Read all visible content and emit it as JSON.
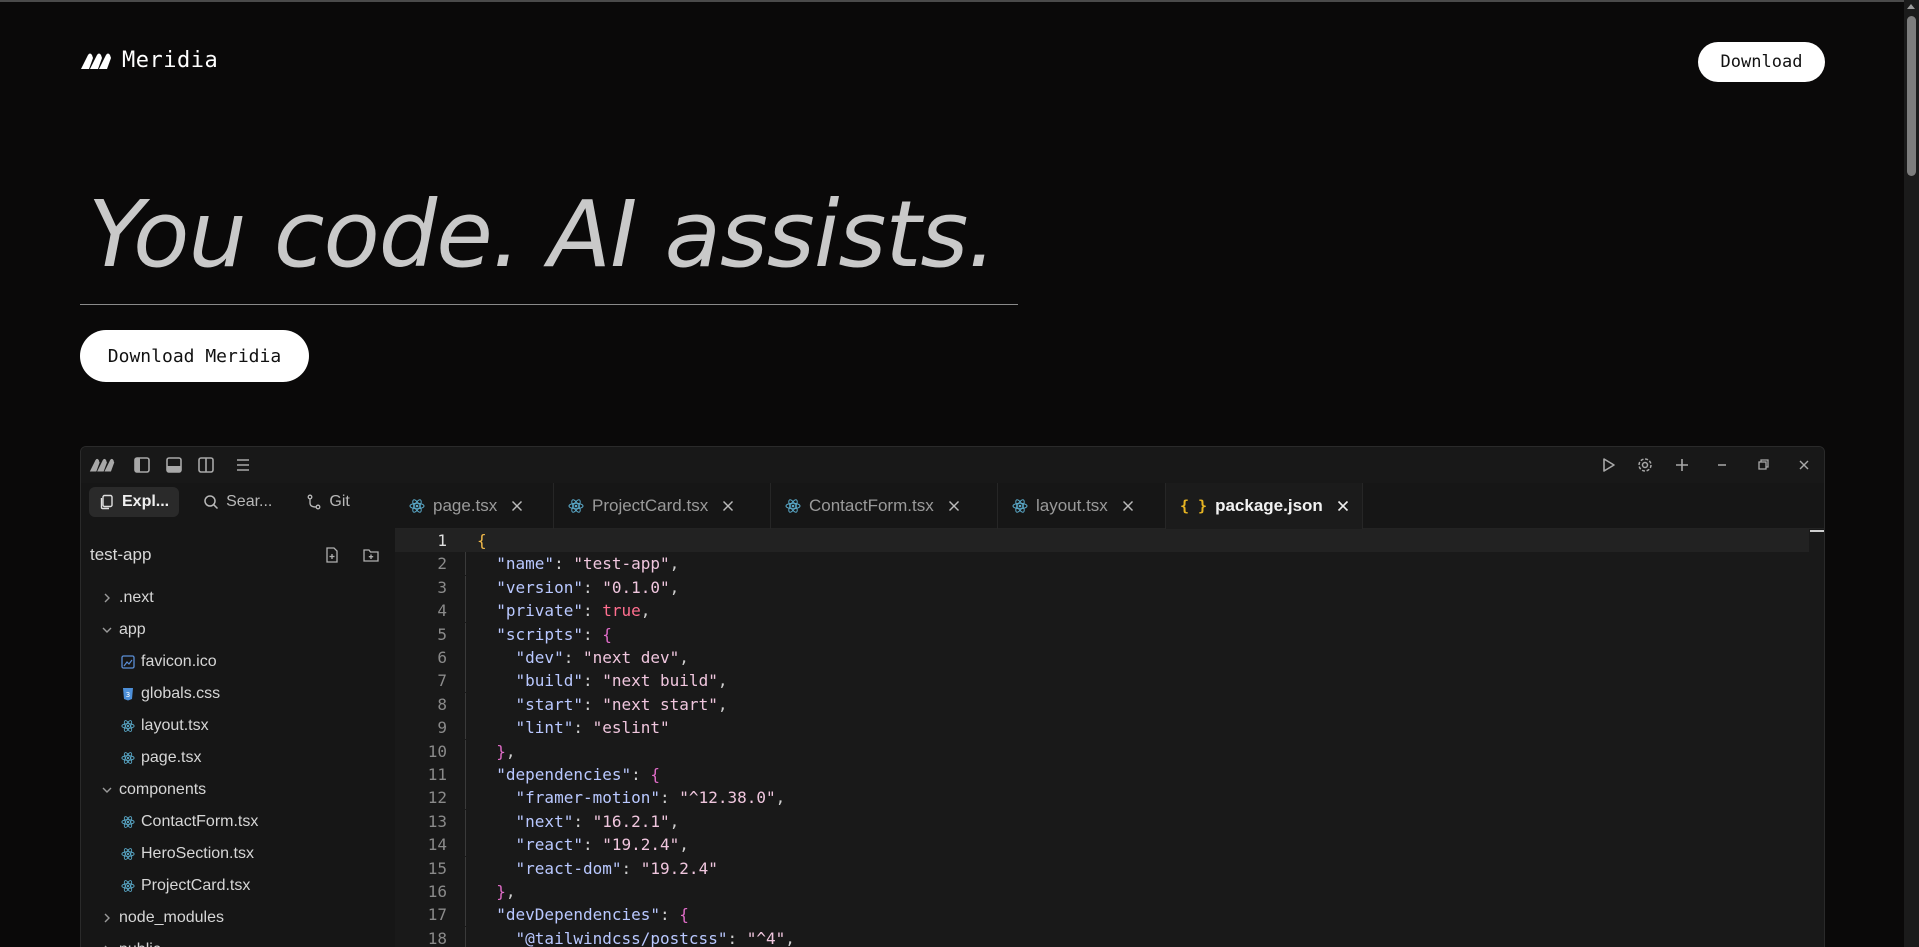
{
  "header": {
    "brand_name": "Meridia",
    "download_label": "Download"
  },
  "hero": {
    "title": "You code. AI assists.",
    "download_label": "Download Meridia"
  },
  "editor": {
    "sidebar": {
      "tabs": [
        {
          "label": "Expl...",
          "icon": "files-icon",
          "active": true
        },
        {
          "label": "Sear...",
          "icon": "search-icon",
          "active": false
        },
        {
          "label": "Git",
          "icon": "git-branch-icon",
          "active": false
        }
      ],
      "project_name": "test-app",
      "tree": [
        {
          "label": ".next",
          "type": "folder",
          "expanded": false,
          "depth": 0
        },
        {
          "label": "app",
          "type": "folder",
          "expanded": true,
          "depth": 0
        },
        {
          "label": "favicon.ico",
          "type": "image",
          "depth": 1
        },
        {
          "label": "globals.css",
          "type": "css",
          "depth": 1
        },
        {
          "label": "layout.tsx",
          "type": "react",
          "depth": 1
        },
        {
          "label": "page.tsx",
          "type": "react",
          "depth": 1
        },
        {
          "label": "components",
          "type": "folder",
          "expanded": true,
          "depth": 0
        },
        {
          "label": "ContactForm.tsx",
          "type": "react",
          "depth": 1
        },
        {
          "label": "HeroSection.tsx",
          "type": "react",
          "depth": 1
        },
        {
          "label": "ProjectCard.tsx",
          "type": "react",
          "depth": 1
        },
        {
          "label": "node_modules",
          "type": "folder",
          "expanded": false,
          "depth": 0
        },
        {
          "label": "public",
          "type": "folder",
          "expanded": false,
          "depth": 0
        }
      ]
    },
    "tabs": [
      {
        "label": "page.tsx",
        "icon": "react-icon",
        "active": false
      },
      {
        "label": "ProjectCard.tsx",
        "icon": "react-icon",
        "active": false
      },
      {
        "label": "ContactForm.tsx",
        "icon": "react-icon",
        "active": false
      },
      {
        "label": "layout.tsx",
        "icon": "react-icon",
        "active": false
      },
      {
        "label": "package.json",
        "icon": "json-icon",
        "active": true
      }
    ],
    "json_icon_glyph": "{ }",
    "code_lines": [
      {
        "n": "1",
        "parts": [
          {
            "c": "bo",
            "t": "{"
          }
        ]
      },
      {
        "n": "2",
        "parts": [
          {
            "c": "p",
            "t": "  "
          },
          {
            "c": "k",
            "t": "\"name\""
          },
          {
            "c": "p",
            "t": ": "
          },
          {
            "c": "s",
            "t": "\"test-app\""
          },
          {
            "c": "p",
            "t": ","
          }
        ]
      },
      {
        "n": "3",
        "parts": [
          {
            "c": "p",
            "t": "  "
          },
          {
            "c": "k",
            "t": "\"version\""
          },
          {
            "c": "p",
            "t": ": "
          },
          {
            "c": "s",
            "t": "\"0.1.0\""
          },
          {
            "c": "p",
            "t": ","
          }
        ]
      },
      {
        "n": "4",
        "parts": [
          {
            "c": "p",
            "t": "  "
          },
          {
            "c": "k",
            "t": "\"private\""
          },
          {
            "c": "p",
            "t": ": "
          },
          {
            "c": "t",
            "t": "true"
          },
          {
            "c": "p",
            "t": ","
          }
        ]
      },
      {
        "n": "5",
        "parts": [
          {
            "c": "p",
            "t": "  "
          },
          {
            "c": "k",
            "t": "\"scripts\""
          },
          {
            "c": "p",
            "t": ": "
          },
          {
            "c": "b",
            "t": "{"
          }
        ]
      },
      {
        "n": "6",
        "parts": [
          {
            "c": "p",
            "t": "    "
          },
          {
            "c": "k",
            "t": "\"dev\""
          },
          {
            "c": "p",
            "t": ": "
          },
          {
            "c": "s",
            "t": "\"next dev\""
          },
          {
            "c": "p",
            "t": ","
          }
        ]
      },
      {
        "n": "7",
        "parts": [
          {
            "c": "p",
            "t": "    "
          },
          {
            "c": "k",
            "t": "\"build\""
          },
          {
            "c": "p",
            "t": ": "
          },
          {
            "c": "s",
            "t": "\"next build\""
          },
          {
            "c": "p",
            "t": ","
          }
        ]
      },
      {
        "n": "8",
        "parts": [
          {
            "c": "p",
            "t": "    "
          },
          {
            "c": "k",
            "t": "\"start\""
          },
          {
            "c": "p",
            "t": ": "
          },
          {
            "c": "s",
            "t": "\"next start\""
          },
          {
            "c": "p",
            "t": ","
          }
        ]
      },
      {
        "n": "9",
        "parts": [
          {
            "c": "p",
            "t": "    "
          },
          {
            "c": "k",
            "t": "\"lint\""
          },
          {
            "c": "p",
            "t": ": "
          },
          {
            "c": "s",
            "t": "\"eslint\""
          }
        ]
      },
      {
        "n": "10",
        "parts": [
          {
            "c": "p",
            "t": "  "
          },
          {
            "c": "b",
            "t": "}"
          },
          {
            "c": "p",
            "t": ","
          }
        ]
      },
      {
        "n": "11",
        "parts": [
          {
            "c": "p",
            "t": "  "
          },
          {
            "c": "k",
            "t": "\"dependencies\""
          },
          {
            "c": "p",
            "t": ": "
          },
          {
            "c": "b",
            "t": "{"
          }
        ]
      },
      {
        "n": "12",
        "parts": [
          {
            "c": "p",
            "t": "    "
          },
          {
            "c": "k",
            "t": "\"framer-motion\""
          },
          {
            "c": "p",
            "t": ": "
          },
          {
            "c": "s",
            "t": "\"^12.38.0\""
          },
          {
            "c": "p",
            "t": ","
          }
        ]
      },
      {
        "n": "13",
        "parts": [
          {
            "c": "p",
            "t": "    "
          },
          {
            "c": "k",
            "t": "\"next\""
          },
          {
            "c": "p",
            "t": ": "
          },
          {
            "c": "s",
            "t": "\"16.2.1\""
          },
          {
            "c": "p",
            "t": ","
          }
        ]
      },
      {
        "n": "14",
        "parts": [
          {
            "c": "p",
            "t": "    "
          },
          {
            "c": "k",
            "t": "\"react\""
          },
          {
            "c": "p",
            "t": ": "
          },
          {
            "c": "s",
            "t": "\"19.2.4\""
          },
          {
            "c": "p",
            "t": ","
          }
        ]
      },
      {
        "n": "15",
        "parts": [
          {
            "c": "p",
            "t": "    "
          },
          {
            "c": "k",
            "t": "\"react-dom\""
          },
          {
            "c": "p",
            "t": ": "
          },
          {
            "c": "s",
            "t": "\"19.2.4\""
          }
        ]
      },
      {
        "n": "16",
        "parts": [
          {
            "c": "p",
            "t": "  "
          },
          {
            "c": "b",
            "t": "}"
          },
          {
            "c": "p",
            "t": ","
          }
        ]
      },
      {
        "n": "17",
        "parts": [
          {
            "c": "p",
            "t": "  "
          },
          {
            "c": "k",
            "t": "\"devDependencies\""
          },
          {
            "c": "p",
            "t": ": "
          },
          {
            "c": "b",
            "t": "{"
          }
        ]
      },
      {
        "n": "18",
        "parts": [
          {
            "c": "p",
            "t": "    "
          },
          {
            "c": "k",
            "t": "\"@tailwindcss/postcss\""
          },
          {
            "c": "p",
            "t": ": "
          },
          {
            "c": "s",
            "t": "\"^4\""
          },
          {
            "c": "p",
            "t": ","
          }
        ]
      }
    ]
  },
  "colors": {
    "background": "#0a0909",
    "button_bg": "#ffffff",
    "json_key": "#b9c8ff",
    "json_string": "#f0c6de",
    "json_bracket": "#e06cc8",
    "json_boolean": "#ff6f8f",
    "react_icon": "#5aa9c9"
  }
}
